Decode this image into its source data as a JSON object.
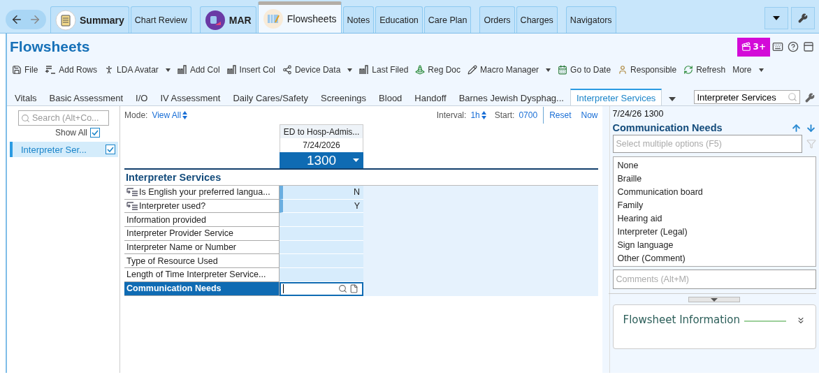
{
  "activity_tabs": [
    {
      "label": "Summary",
      "kind": "icon",
      "selected": false
    },
    {
      "label": "Chart Review",
      "kind": "plain",
      "selected": false
    },
    {
      "label": "MAR",
      "kind": "icon",
      "selected": false
    },
    {
      "label": "Flowsheets",
      "kind": "icon",
      "selected": true
    },
    {
      "label": "Notes",
      "kind": "plain",
      "selected": false
    },
    {
      "label": "Education",
      "kind": "plain",
      "selected": false
    },
    {
      "label": "Care Plan",
      "kind": "plain",
      "selected": false
    },
    {
      "label": "Orders",
      "kind": "plain",
      "selected": false
    },
    {
      "label": "Charges",
      "kind": "plain",
      "selected": false
    },
    {
      "label": "Navigators",
      "kind": "plain",
      "selected": false
    }
  ],
  "title": "Flowsheets",
  "badge": "3+",
  "toolbar": [
    {
      "label": "File",
      "dropdown": false
    },
    {
      "label": "Add Rows",
      "dropdown": false
    },
    {
      "label": "LDA Avatar",
      "dropdown": true
    },
    {
      "label": "Add Col",
      "dropdown": false
    },
    {
      "label": "Insert Col",
      "dropdown": false
    },
    {
      "label": "Device Data",
      "dropdown": true
    },
    {
      "label": "Last Filed",
      "dropdown": false
    },
    {
      "label": "Reg Doc",
      "dropdown": false
    },
    {
      "label": "Macro Manager",
      "dropdown": true
    },
    {
      "label": "Go to Date",
      "dropdown": false
    },
    {
      "label": "Responsible",
      "dropdown": false
    },
    {
      "label": "Refresh",
      "dropdown": false
    },
    {
      "label": "More",
      "dropdown": true
    }
  ],
  "section_tabs": [
    {
      "label": "Vitals",
      "selected": false
    },
    {
      "label": "Basic Assessment",
      "selected": false
    },
    {
      "label": "I/O",
      "selected": false
    },
    {
      "label": "IV Assessment",
      "selected": false
    },
    {
      "label": "Daily Cares/Safety",
      "selected": false
    },
    {
      "label": "Screenings",
      "selected": false
    },
    {
      "label": "Blood",
      "selected": false
    },
    {
      "label": "Handoff",
      "selected": false
    },
    {
      "label": "Barnes Jewish Dysphag...",
      "selected": false
    },
    {
      "label": "Interpreter Services",
      "selected": true
    }
  ],
  "section_search": {
    "value": "Interpreter Services"
  },
  "sidebar": {
    "search_placeholder": "Search (Alt+Co...",
    "show_all": {
      "label": "Show All",
      "checked": true
    },
    "groups": [
      {
        "label": "Interpreter Ser...",
        "checked": true,
        "selected": true
      }
    ]
  },
  "grid": {
    "mode_label": "Mode:",
    "mode": "View All",
    "interval_label": "Interval:",
    "interval": "1h",
    "start_label": "Start:",
    "start": "0700",
    "reset": "Reset",
    "now": "Now",
    "column": {
      "encounter": "ED to Hosp-Admis...",
      "date": "7/24/2026",
      "time": "1300"
    },
    "section": "Interpreter Services",
    "rows": [
      {
        "label": "Is English your preferred langua...",
        "value": "N",
        "kind": "linked",
        "selected": false
      },
      {
        "label": "Interpreter used?",
        "value": "Y",
        "kind": "linked",
        "selected": false
      },
      {
        "label": "Information provided",
        "kind": "plain",
        "selected": false
      },
      {
        "label": "Interpreter Provider Service",
        "kind": "plain",
        "selected": false
      },
      {
        "label": "Interpreter Name or Number",
        "kind": "plain",
        "selected": false
      },
      {
        "label": "Type of Resource Used",
        "kind": "plain",
        "selected": false
      },
      {
        "label": "Length of Time Interpreter Service...",
        "kind": "plain",
        "selected": false
      },
      {
        "label": "Communication Needs",
        "kind": "plain",
        "selected": true
      }
    ]
  },
  "detail": {
    "timestamp": "7/24/26 1300",
    "title": "Communication Needs",
    "select_placeholder": "Select multiple options (F5)",
    "options": [
      "None",
      "Braille",
      "Communication board",
      "Family",
      "Hearing aid",
      "Interpreter (Legal)",
      "Sign language",
      "Other (Comment)"
    ],
    "comments_placeholder": "Comments (Alt+M)",
    "info_title": "Flowsheet Information"
  }
}
